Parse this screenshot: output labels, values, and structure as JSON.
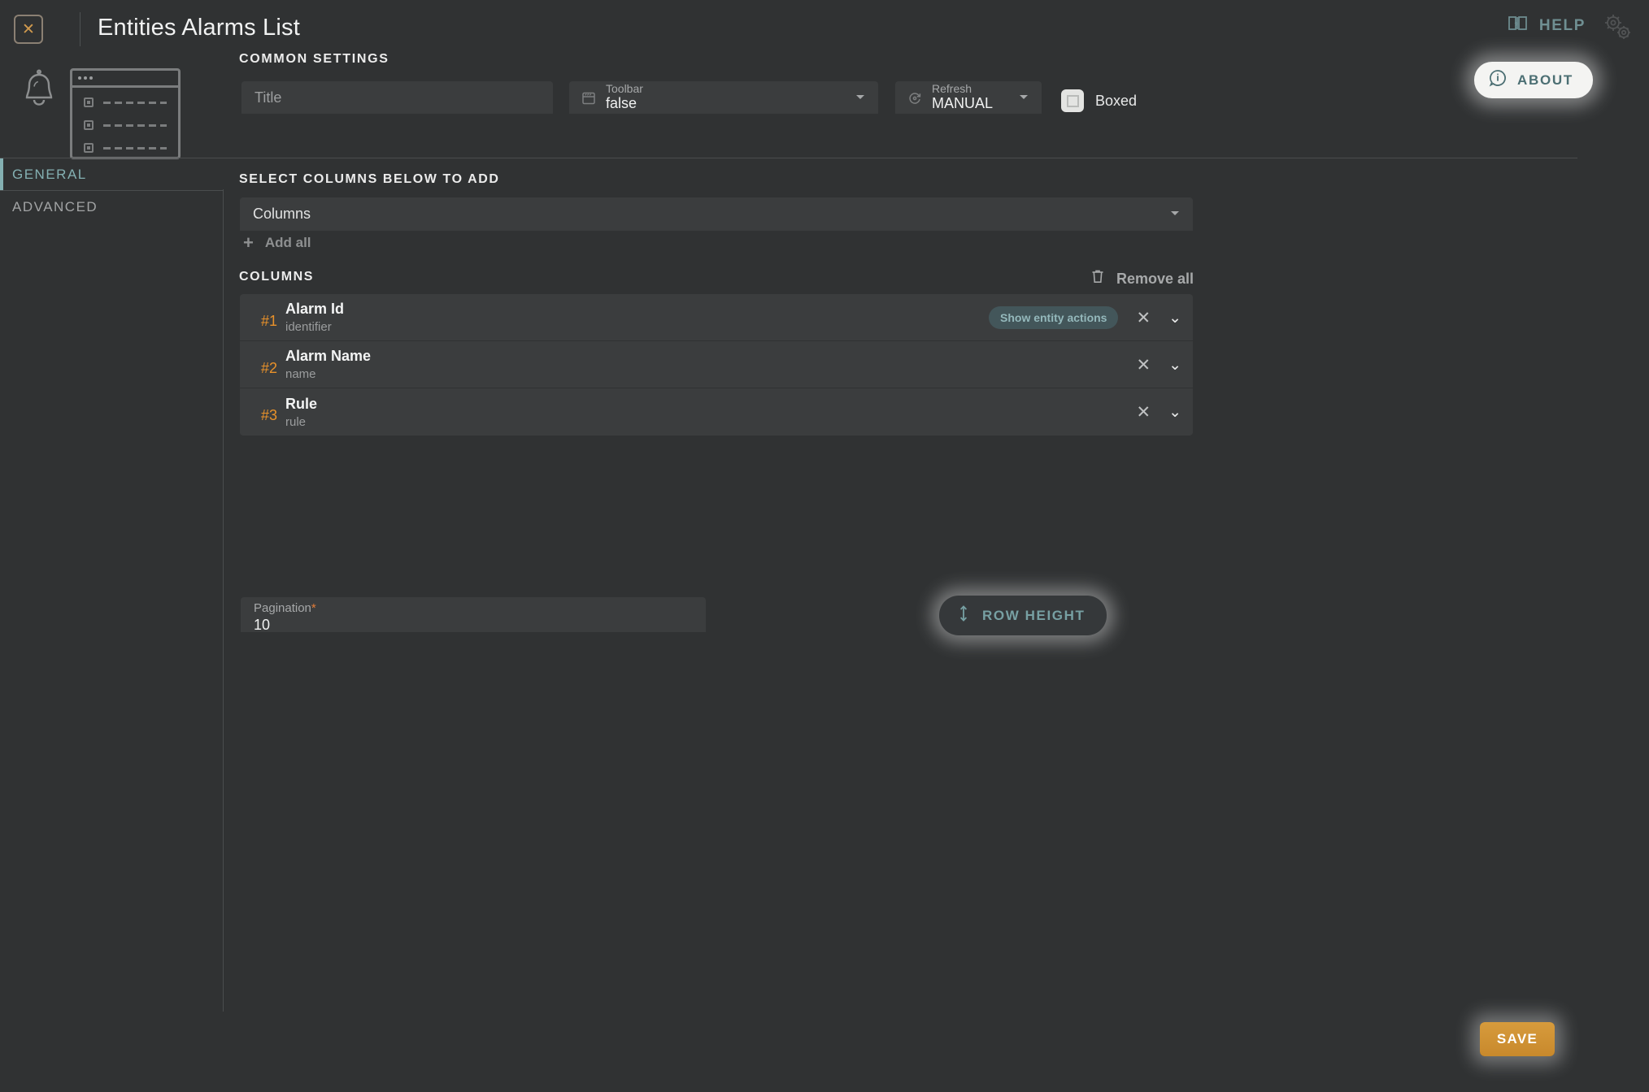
{
  "window": {
    "title": "Entities Alarms List",
    "close_label": "✕"
  },
  "topbar": {
    "help_label": "HELP",
    "about_label": "ABOUT",
    "help_icon": "book-question-icon",
    "about_icon": "info-circle-icon",
    "settings_icon": "gears-icon"
  },
  "common_settings": {
    "heading": "COMMON SETTINGS",
    "title_field": {
      "placeholder": "Title",
      "value": ""
    },
    "toolbar_select": {
      "label": "Toolbar",
      "value": "false",
      "icon": "toolbar-icon"
    },
    "refresh_select": {
      "label": "Refresh",
      "value": "MANUAL",
      "icon": "refresh-icon"
    },
    "boxed_checkbox": {
      "label": "Boxed",
      "checked": false
    }
  },
  "tabs": [
    {
      "label": "GENERAL",
      "active": true
    },
    {
      "label": "ADVANCED",
      "active": false
    }
  ],
  "main": {
    "select_columns_heading": "SELECT COLUMNS BELOW TO ADD",
    "columns_select_placeholder": "Columns",
    "add_all_label": "Add all",
    "columns_heading": "COLUMNS",
    "remove_all_label": "Remove all",
    "columns": [
      {
        "index": "#1",
        "title": "Alarm Id",
        "subtitle": "identifier",
        "badge": "Show entity actions"
      },
      {
        "index": "#2",
        "title": "Alarm Name",
        "subtitle": "name",
        "badge": ""
      },
      {
        "index": "#3",
        "title": "Rule",
        "subtitle": "rule",
        "badge": ""
      }
    ],
    "pagination": {
      "label": "Pagination",
      "required": "*",
      "value": "10"
    },
    "row_height_label": "ROW HEIGHT"
  },
  "footer": {
    "save_label": "SAVE"
  },
  "colors": {
    "background": "#303233",
    "panel": "#3b3d3e",
    "accent_teal": "#84b0b2",
    "accent_orange": "#e8912a",
    "save_orange": "#d79b3c",
    "divider": "#4a4d4e"
  }
}
